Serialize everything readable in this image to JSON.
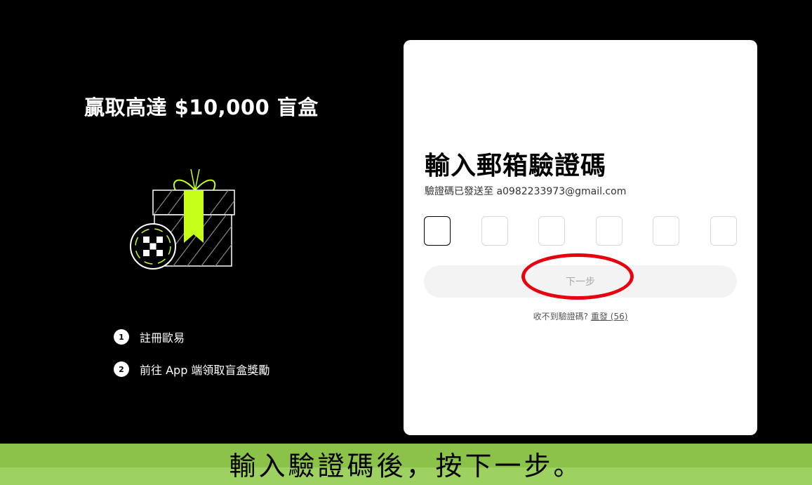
{
  "left": {
    "title": "贏取高達 $10,000 盲盒",
    "steps": [
      {
        "num": "1",
        "label": "註冊歐易"
      },
      {
        "num": "2",
        "label": "前往 App 端領取盲盒獎勵"
      }
    ],
    "illustration": "gift-box-icon"
  },
  "card": {
    "title": "輸入郵箱驗證碼",
    "subtitle": "驗證碼已發送至 a0982233973@gmail.com",
    "code_boxes": [
      "",
      "",
      "",
      "",
      "",
      ""
    ],
    "next_label": "下一步",
    "resend_prompt": "收不到驗證碼?",
    "resend_link": "重發 (56)"
  },
  "caption": {
    "text": "輸入驗證碼後，按下一步。"
  },
  "colors": {
    "accent_lime": "#c6ff1a",
    "highlight_red": "#e8000f",
    "caption_green": "#8bc34a"
  }
}
